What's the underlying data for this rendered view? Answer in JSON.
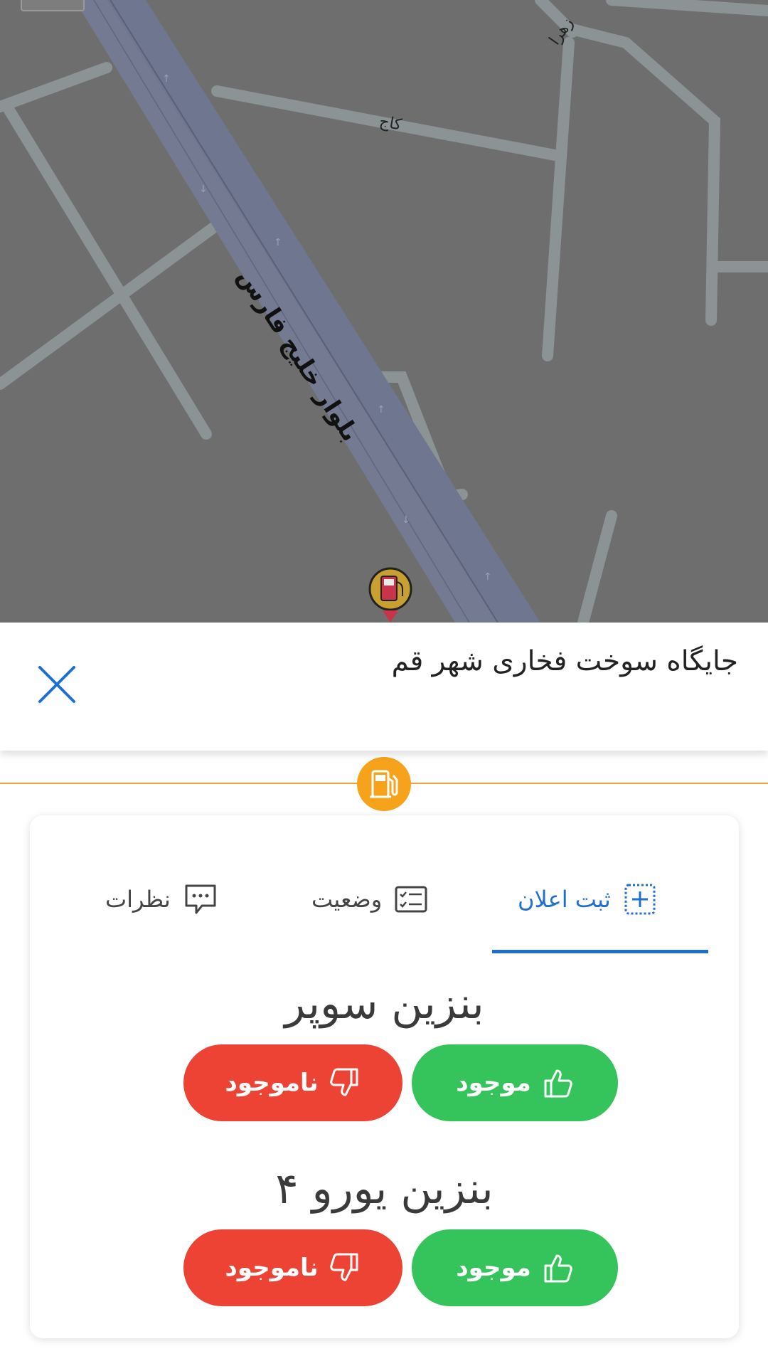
{
  "map": {
    "road_main": "بلوار خلیج فارس",
    "street_kaj": "کاج",
    "street_zahra": "زهرا"
  },
  "place": {
    "title": "جایگاه سوخت فخاری شهر قم",
    "icons": [
      "route-icon",
      "share-link-icon",
      "favorite-star-icon"
    ],
    "close_icon": "close-icon"
  },
  "tabs": [
    {
      "label": "ثبت اعلان",
      "icon": "add-notification-icon",
      "active": true
    },
    {
      "label": "وضعیت",
      "icon": "status-checklist-icon",
      "active": false
    },
    {
      "label": "نظرات",
      "icon": "comments-icon",
      "active": false
    }
  ],
  "fuels": [
    {
      "name": "بنزین سوپر",
      "available_label": "موجود",
      "unavailable_label": "ناموجود"
    },
    {
      "name": "بنزین یورو ۴",
      "available_label": "موجود",
      "unavailable_label": "ناموجود"
    }
  ],
  "colors": {
    "accent_blue": "#1e6fd0",
    "available_green": "#35c45b",
    "unavailable_red": "#ec4334",
    "fuel_orange": "#f7a21b"
  }
}
